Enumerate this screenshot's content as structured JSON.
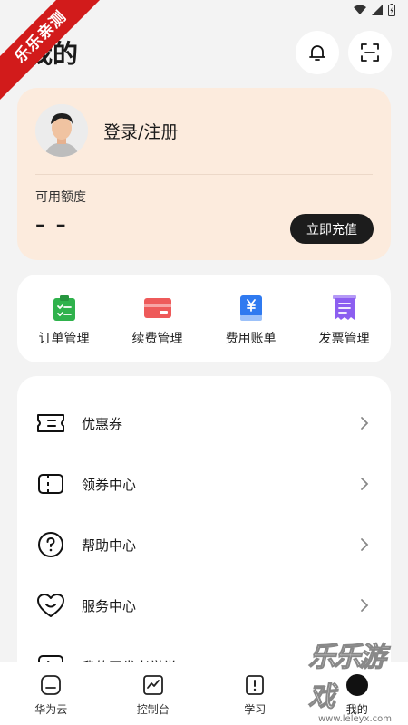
{
  "watermark": {
    "ribbon": "乐乐亲测"
  },
  "header": {
    "title": "我的"
  },
  "profile": {
    "login_text": "登录/注册",
    "quota_label": "可用额度",
    "quota_value": "– –",
    "recharge_label": "立即充值"
  },
  "quick_actions": [
    {
      "label": "订单管理",
      "icon": "clipboard-icon",
      "color": "#2fb24c"
    },
    {
      "label": "续费管理",
      "icon": "card-icon",
      "color": "#ee5a5a"
    },
    {
      "label": "费用账单",
      "icon": "yen-book-icon",
      "color": "#2f7af0"
    },
    {
      "label": "发票管理",
      "icon": "invoice-icon",
      "color": "#8c5ef0"
    }
  ],
  "menu": [
    {
      "label": "优惠券",
      "icon": "coupon-icon"
    },
    {
      "label": "领券中心",
      "icon": "ticket-icon"
    },
    {
      "label": "帮助中心",
      "icon": "help-icon"
    },
    {
      "label": "服务中心",
      "icon": "heart-icon"
    },
    {
      "label": "我的开发者学堂",
      "icon": "video-icon"
    }
  ],
  "tabs": [
    {
      "label": "华为云",
      "icon": "home-icon"
    },
    {
      "label": "控制台",
      "icon": "console-icon"
    },
    {
      "label": "学习",
      "icon": "book-icon"
    },
    {
      "label": "我的",
      "icon": "me-icon"
    }
  ],
  "brand_watermark": {
    "text": "乐乐游戏",
    "url": "www.leleyx.com"
  },
  "colors": {
    "card_bg": "#fcebdd",
    "accent_dark": "#1c1c1c"
  }
}
